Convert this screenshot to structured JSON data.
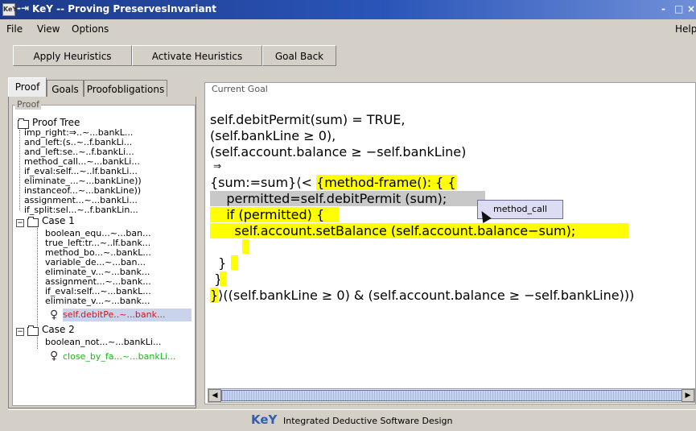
{
  "window": {
    "app_icon": "KeY",
    "pin_glyph": "-⇥",
    "title": "KeY -- Proving PreservesInvariant",
    "controls": [
      "-",
      "□",
      "×"
    ]
  },
  "menu": {
    "file": "File",
    "view": "View",
    "options": "Options",
    "help": "Help"
  },
  "toolbar": {
    "apply": "Apply Heuristics",
    "activate": "Activate Heuristics",
    "goal_back": "Goal Back"
  },
  "tabs": {
    "proof": "Proof",
    "goals": "Goals",
    "proofobligations": "Proofobligations"
  },
  "proof_panel": {
    "group_label": "Proof",
    "root_label": "Proof Tree",
    "items": [
      "imp_right:⇒..~...bankL...",
      "and_left:(s..~..f.bankLi...",
      "and_left:se..~..f.bankLi...",
      "method_call...~...bankLi...",
      "if_eval:self...~..lf.bankLi...",
      "eliminate_...~...bankLine))",
      "instanceof...~...bankLine))",
      "assignment...~...bankLi...",
      "if_split:sel...~..f.bankLin..."
    ],
    "case1": {
      "label": "Case 1",
      "items": [
        "boolean_equ...~...ban...",
        "true_left:tr...~..lf.bank...",
        "method_bo...~..bankL...",
        "variable_de...~...ban...",
        "eliminate_v...~...bank...",
        "assignment...~...bank...",
        "if_eval:self...~...bankL...",
        "eliminate_v...~...bank..."
      ],
      "open_goal": "self.debitPe..~...bank..."
    },
    "case2": {
      "label": "Case 2",
      "items": [
        "boolean_not...~...bankLi..."
      ],
      "closed_goal": "close_by_fa...~...bankLi..."
    }
  },
  "goal_panel": {
    "label": "Current Goal",
    "lines": {
      "l1": "self.debitPermit(sum) = TRUE,",
      "l2": "(self.bankLine ≥ 0),",
      "l3": "(self.account.balance ≥ −self.bankLine)",
      "l4": "⇒",
      "l5a": "{sum:=sum}⟨< ",
      "l5b": "{method-frame(): { {",
      "l6a": "    permitted=self.debitPermit (sum);",
      "l7": "    if (permitted) {",
      "l8": "      self.account.setBalance (self.account.balance−sum);",
      "l9": "    }",
      "l10": "  }",
      "l11": " }",
      "l12a": "}",
      "l12b": "⟩((self.bankLine ≥ 0) & (self.account.balance ≥ −self.bankLine)))"
    },
    "popup": "method_call"
  },
  "status": {
    "logo": "KeY",
    "text": "Integrated Deductive Software Design"
  },
  "colors": {
    "title_bar": "#1d3a8a",
    "highlight_yellow": "#ffff00",
    "highlight_gray": "#c8c8c8",
    "open_goal": "#d01818",
    "closed_goal": "#18b818"
  }
}
